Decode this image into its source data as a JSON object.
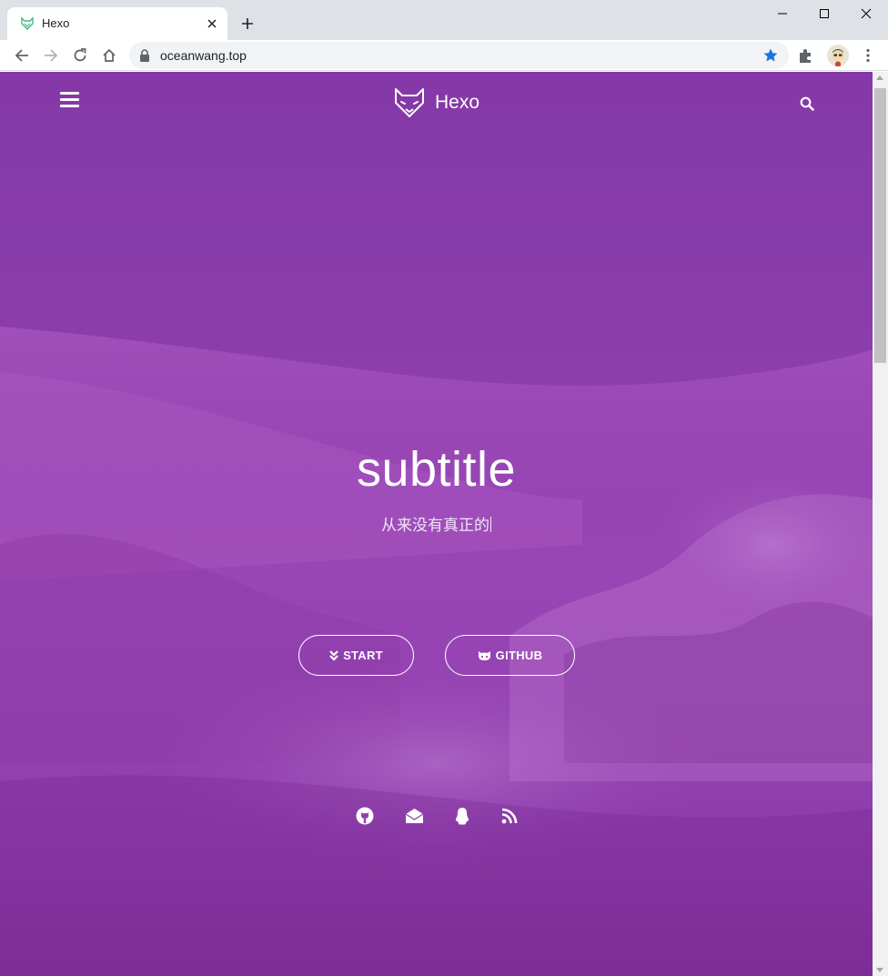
{
  "browser": {
    "tab_title": "Hexo",
    "url": "oceanwang.top",
    "colors": {
      "frame": "#dee1e6",
      "star": "#1a73e8"
    }
  },
  "site": {
    "brand": "Hexo",
    "hero_title": "subtitle",
    "hero_subtitle": "从来没有真正的",
    "buttons": {
      "start_label": "START",
      "github_label": "GITHUB"
    },
    "social_icons": [
      "github-icon",
      "email-icon",
      "qq-icon",
      "rss-icon"
    ],
    "colors": {
      "hero_top": "#8538a8",
      "hero_mid": "#9a46b6",
      "hero_bottom": "#7e2e98"
    }
  }
}
